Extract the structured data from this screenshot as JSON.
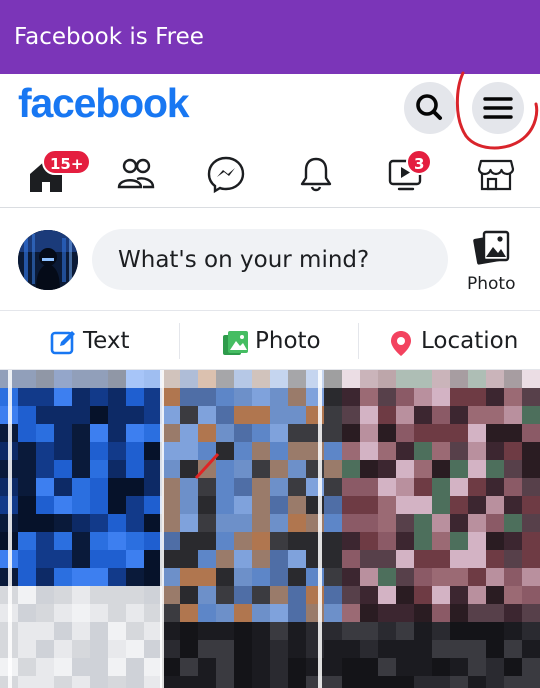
{
  "promo": {
    "text": "Facebook is Free"
  },
  "header": {
    "logo": "facebook",
    "search_icon": "search-icon",
    "menu_icon": "hamburger-menu-icon"
  },
  "nav": {
    "items": [
      {
        "name": "home",
        "icon": "home-icon",
        "badge": "15+"
      },
      {
        "name": "friends",
        "icon": "friends-icon",
        "badge": ""
      },
      {
        "name": "messenger",
        "icon": "messenger-icon",
        "badge": ""
      },
      {
        "name": "notifications",
        "icon": "bell-icon",
        "badge": ""
      },
      {
        "name": "watch",
        "icon": "video-icon",
        "badge": "3"
      },
      {
        "name": "marketplace",
        "icon": "store-icon",
        "badge": ""
      }
    ]
  },
  "composer": {
    "placeholder": "What's on your mind?",
    "photo_label": "Photo"
  },
  "actions": [
    {
      "label": "Text",
      "icon": "edit-icon",
      "color": "#1877f2"
    },
    {
      "label": "Photo",
      "icon": "photo-icon",
      "color": "#45bd62"
    },
    {
      "label": "Location",
      "icon": "location-pin-icon",
      "color": "#f3425f"
    }
  ],
  "colors": {
    "brand": "#1877f2",
    "promo": "#7b35b8",
    "badge": "#e41e3f",
    "annotation": "#d9242b"
  }
}
